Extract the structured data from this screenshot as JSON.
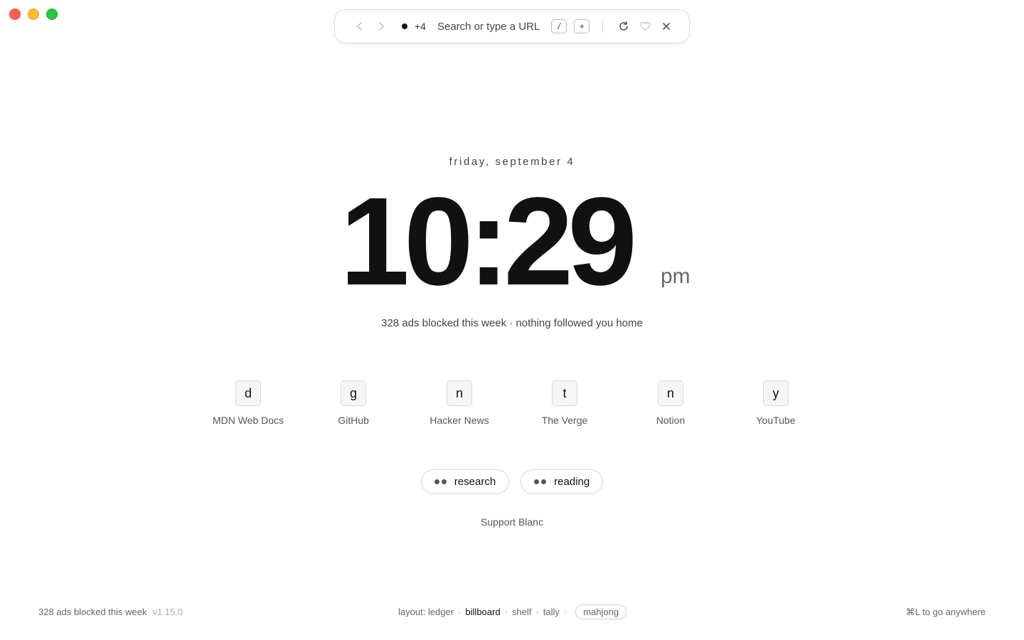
{
  "toolbar": {
    "tab_count": "+4",
    "url_placeholder": "Search or type a URL",
    "slash_key": "/",
    "new_tab_key": "+"
  },
  "clock": {
    "date": "friday, september 4",
    "time": "10:29",
    "ampm": "pm",
    "tagline": "328 ads blocked this week · nothing followed you home"
  },
  "shortcuts": [
    {
      "letter": "d",
      "label": "MDN Web Docs"
    },
    {
      "letter": "g",
      "label": "GitHub"
    },
    {
      "letter": "n",
      "label": "Hacker News"
    },
    {
      "letter": "t",
      "label": "The Verge"
    },
    {
      "letter": "n",
      "label": "Notion"
    },
    {
      "letter": "y",
      "label": "YouTube"
    }
  ],
  "spaces": [
    {
      "label": "research"
    },
    {
      "label": "reading"
    }
  ],
  "support_link": "Support Blanc",
  "footer": {
    "ads_blocked": "328 ads blocked this week",
    "version": "v1.15.0",
    "layout_label": "layout:",
    "layouts": [
      "ledger",
      "billboard",
      "shelf",
      "tally",
      "mahjong"
    ],
    "active_layout": "billboard",
    "hint": "⌘L to go anywhere"
  }
}
